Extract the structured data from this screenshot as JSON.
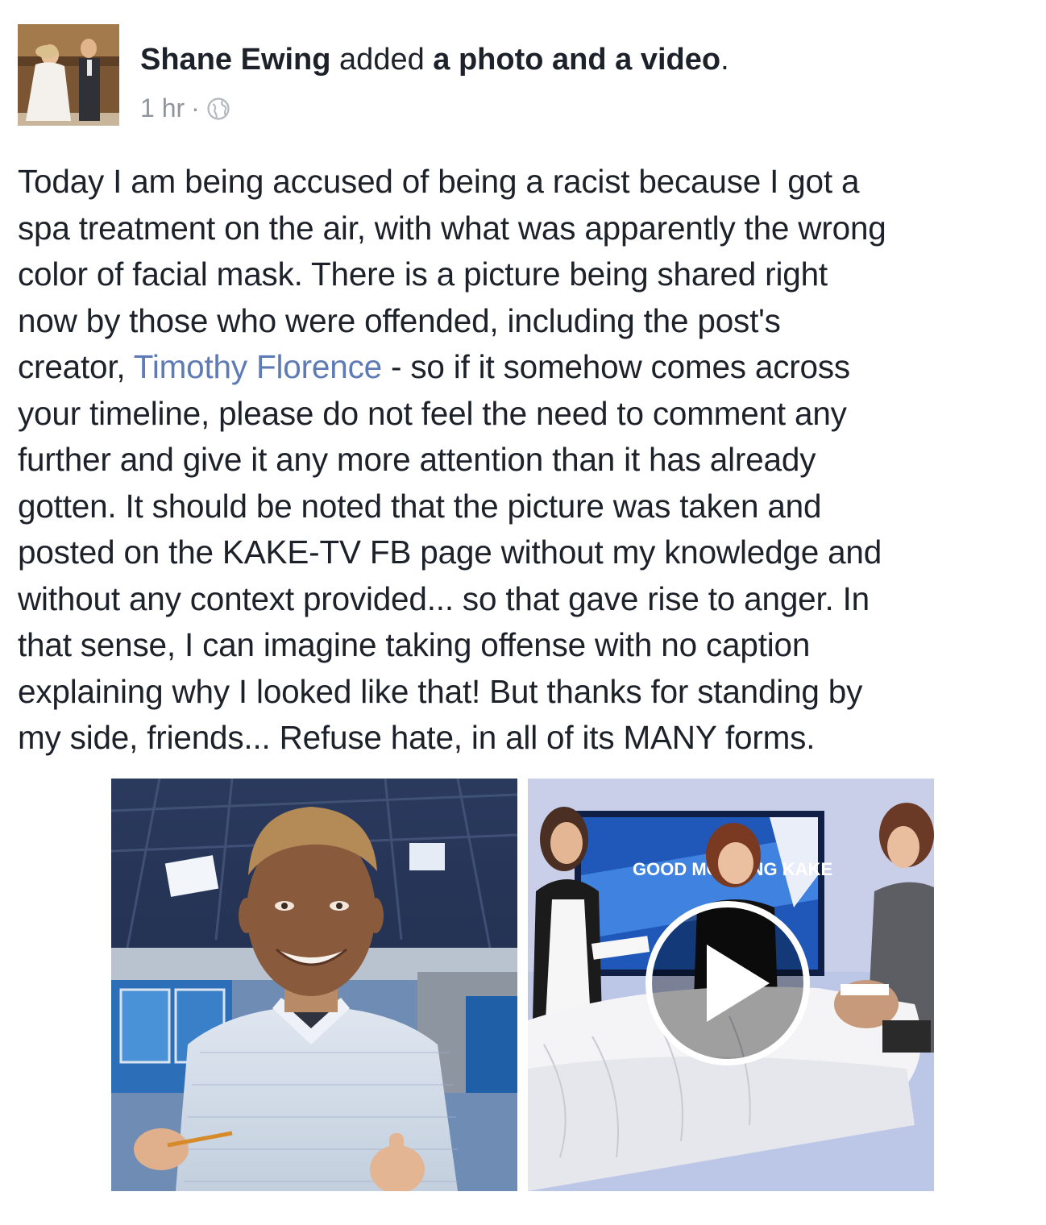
{
  "post": {
    "author": "Shane Ewing",
    "action_verb": "added",
    "action_object": "a photo and a video",
    "action_period": ".",
    "timestamp": "1 hr",
    "separator": "·",
    "privacy_icon": "globe-icon",
    "body_lines": [
      "Today I am being accused of being a racist because I got a",
      "spa treatment on the air, with what was apparently the wrong",
      "color of facial mask. There is a picture being shared right",
      "now by those who were offended, including the post's",
      null,
      "your timeline, please do not feel the need to comment any",
      "further and give it any more attention than it has already",
      "gotten. It should be noted that the picture was taken and",
      "posted on the KAKE-TV FB page without my knowledge and",
      "without any context provided... so that gave rise to anger. In",
      "that sense, I can imagine taking offense with no caption",
      "explaining why I looked like that! But thanks for standing by",
      "my side, friends... Refuse hate, in all of its MANY forms."
    ],
    "line5": {
      "before": "creator, ",
      "mention": "Timothy Florence",
      "after": " - so if it somehow comes across"
    },
    "video_overlay_text": "GOOD MORNING KAKE",
    "colors": {
      "text": "#1d2129",
      "secondary": "#90949c",
      "mention": "#5f7bb5"
    }
  }
}
